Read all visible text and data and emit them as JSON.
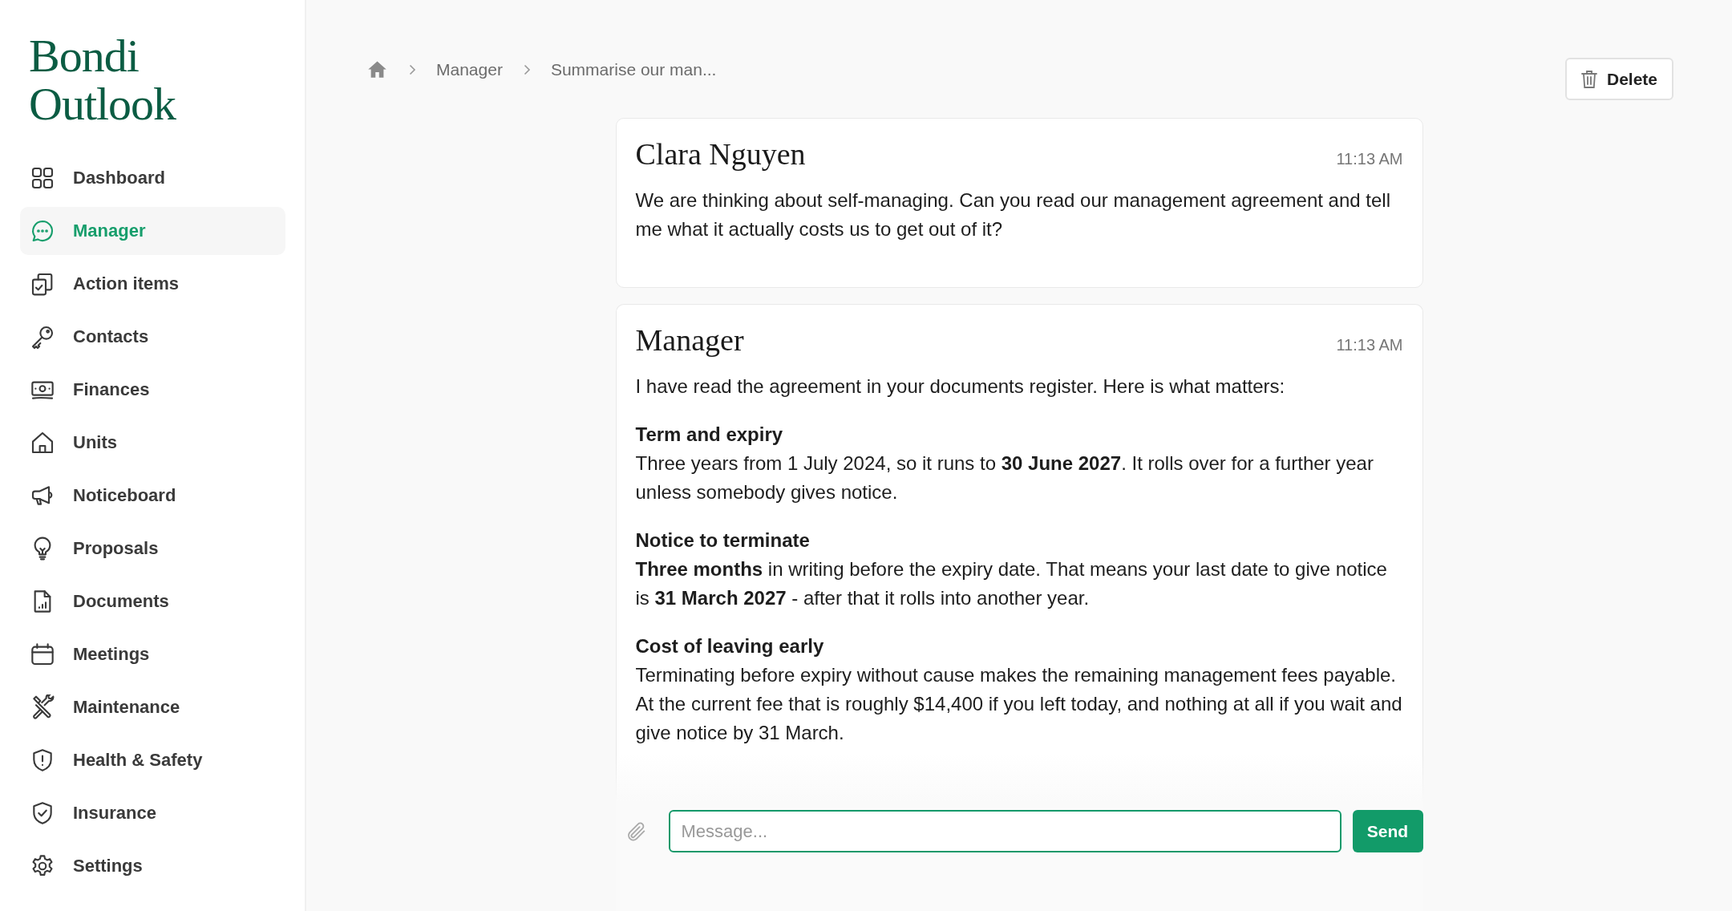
{
  "logo": "Bondi Outlook",
  "sidebar": {
    "items": [
      {
        "label": "Dashboard",
        "selected": false
      },
      {
        "label": "Manager",
        "selected": true
      },
      {
        "label": "Action items",
        "selected": false
      },
      {
        "label": "Contacts",
        "selected": false
      },
      {
        "label": "Finances",
        "selected": false
      },
      {
        "label": "Units",
        "selected": false
      },
      {
        "label": "Noticeboard",
        "selected": false
      },
      {
        "label": "Proposals",
        "selected": false
      },
      {
        "label": "Documents",
        "selected": false
      },
      {
        "label": "Meetings",
        "selected": false
      },
      {
        "label": "Maintenance",
        "selected": false
      },
      {
        "label": "Health & Safety",
        "selected": false
      },
      {
        "label": "Insurance",
        "selected": false
      },
      {
        "label": "Settings",
        "selected": false
      }
    ]
  },
  "breadcrumb": [
    "Manager",
    "Summarise our man..."
  ],
  "delete_button": "Delete",
  "messages": [
    {
      "author": "Clara Nguyen",
      "time": "11:13 AM",
      "blocks": [
        {
          "body": "We are thinking about self-managing. Can you read our management agreement and tell me what it actually costs us to get out of it?"
        }
      ]
    },
    {
      "author": "Manager",
      "time": "11:13 AM",
      "blocks": [
        {
          "body": "I have read the agreement in your documents register. Here is what matters:"
        },
        {
          "heading": "Term and expiry",
          "body": "Three years from 1 July 2024, so it runs to **30 June 2027**. It rolls over for a further year unless somebody gives notice."
        },
        {
          "heading": "Notice to terminate",
          "body": "**Three months** in writing before the expiry date. That means your last date to give notice is **31 March 2027** - after that it rolls into another year."
        },
        {
          "heading": "Cost of leaving early",
          "body": "Terminating before expiry without cause makes the remaining management fees payable. At the current fee that is roughly $14,400 if you left today, and nothing at all if you wait and give notice by 31 March."
        }
      ]
    }
  ],
  "composer": {
    "placeholder": "Message...",
    "send": "Send"
  }
}
